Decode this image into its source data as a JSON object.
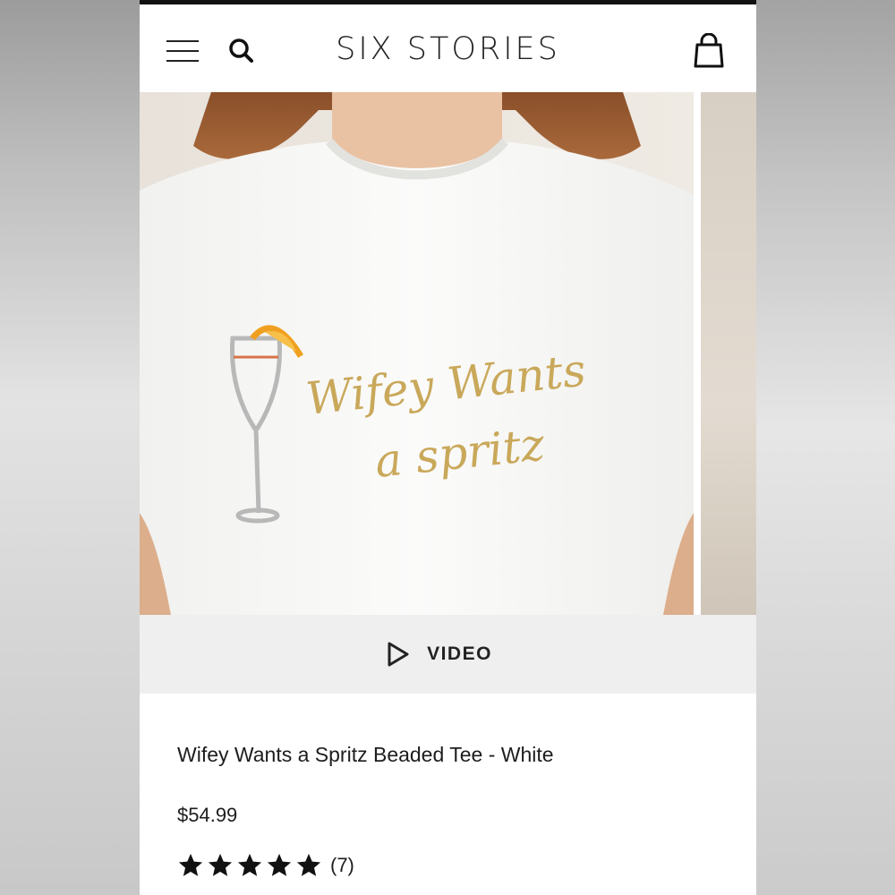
{
  "header": {
    "brand": "SIX STORIES",
    "menu_icon": "hamburger-menu-icon",
    "search_icon": "search-icon",
    "cart_icon": "shopping-bag-icon"
  },
  "gallery": {
    "shirt_text_line1": "Wifey Wants",
    "shirt_text_line2": "a spritz"
  },
  "video": {
    "label": "VIDEO",
    "icon": "play-icon"
  },
  "product": {
    "title": "Wifey Wants a Spritz Beaded Tee - White",
    "price": "$54.99",
    "rating": 5,
    "review_count": "(7)"
  },
  "colors": {
    "text": "#1d1d1d",
    "video_bar_bg": "#efefef",
    "bead_gold": "#c9a85a",
    "orange_slice": "#f0a020"
  }
}
